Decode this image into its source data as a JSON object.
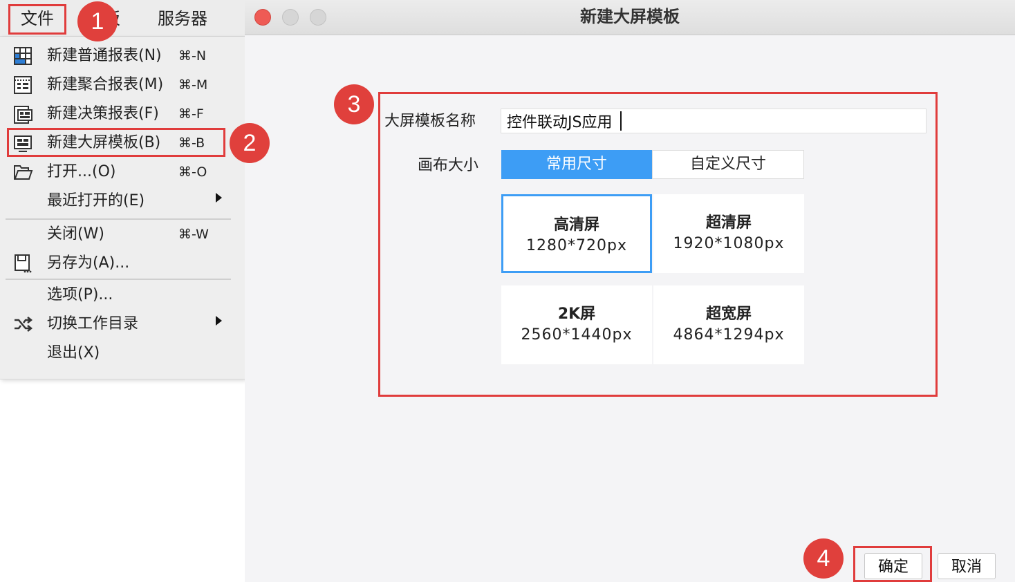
{
  "menubar": {
    "file": "文件",
    "hidden_item": "板",
    "server": "服务器"
  },
  "menu": {
    "items": [
      {
        "label": "新建普通报表(N)",
        "shortcut": "⌘-N",
        "icon": "grid-report-icon"
      },
      {
        "label": "新建聚合报表(M)",
        "shortcut": "⌘-M",
        "icon": "aggregate-report-icon"
      },
      {
        "label": "新建决策报表(F)",
        "shortcut": "⌘-F",
        "icon": "decision-report-icon"
      },
      {
        "label": "新建大屏模板(B)",
        "shortcut": "⌘-B",
        "icon": "screen-template-icon"
      },
      {
        "label": "打开...(O)",
        "shortcut": "⌘-O",
        "icon": "folder-open-icon"
      },
      {
        "label": "最近打开的(E)",
        "shortcut": "",
        "submenu": true
      },
      {
        "label": "关闭(W)",
        "shortcut": "⌘-W"
      },
      {
        "label": "另存为(A)...",
        "shortcut": "",
        "icon": "save-as-icon"
      },
      {
        "label": "选项(P)...",
        "shortcut": ""
      },
      {
        "label": "切换工作目录",
        "shortcut": "",
        "icon": "switch-directory-icon",
        "submenu": true
      },
      {
        "label": "退出(X)",
        "shortcut": ""
      }
    ]
  },
  "dialog": {
    "title": "新建大屏模板",
    "name_label": "大屏模板名称",
    "name_value": "控件联动JS应用",
    "canvas_label": "画布大小",
    "tabs": {
      "common": "常用尺寸",
      "custom": "自定义尺寸"
    },
    "sizes": [
      {
        "name": "高清屏",
        "px": "1280*720px",
        "selected": true
      },
      {
        "name": "超清屏",
        "px": "1920*1080px",
        "selected": false
      },
      {
        "name": "2K屏",
        "px": "2560*1440px",
        "selected": false
      },
      {
        "name": "超宽屏",
        "px": "4864*1294px",
        "selected": false
      }
    ],
    "ok": "确定",
    "cancel": "取消"
  },
  "annotations": {
    "step1": "1",
    "step2": "2",
    "step3": "3",
    "step4": "4"
  },
  "colors": {
    "accent_blue": "#3d9df5",
    "annotation_red": "#e03c3c"
  }
}
